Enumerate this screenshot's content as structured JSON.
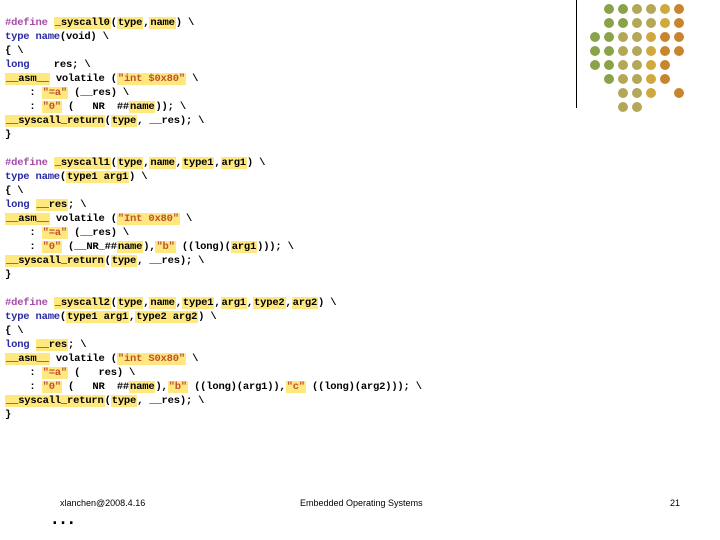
{
  "footer": {
    "left": "xlanchen@2008.4.16",
    "center": "Embedded Operating Systems",
    "page": "21"
  },
  "ellipsis": "…",
  "dot_colors": {
    "g": "#8aa34a",
    "go": "#b3a758",
    "o": "#cfa83e",
    "do": "#c7862e"
  },
  "dots_layout": [
    [
      "",
      "g",
      "g",
      "go",
      "go",
      "o",
      "do"
    ],
    [
      "",
      "g",
      "g",
      "go",
      "go",
      "o",
      "do"
    ],
    [
      "g",
      "g",
      "go",
      "go",
      "o",
      "do",
      "do"
    ],
    [
      "g",
      "g",
      "go",
      "go",
      "o",
      "do",
      "do"
    ],
    [
      "g",
      "g",
      "go",
      "go",
      "o",
      "do",
      ""
    ],
    [
      "",
      "g",
      "go",
      "go",
      "o",
      "do",
      ""
    ],
    [
      "",
      "",
      "go",
      "go",
      "o",
      "",
      "do"
    ],
    [
      "",
      "",
      "go",
      "go",
      "",
      "",
      ""
    ]
  ],
  "code": {
    "b0": {
      "l1a": "#define ",
      "l1b": "_syscall0",
      "l1c": "(",
      "l1d": "type",
      "l1e": ",",
      "l1f": "name",
      "l1g": ") \\",
      "l2a": "type name",
      "l2b": "(void) \\",
      "l3": "{ \\",
      "l4a": "long",
      "l4b": "    res; \\",
      "l5a": "__asm__",
      "l5b": " volatile (",
      "l5c": "\"int $0x80\"",
      "l5d": " \\",
      "l6a": "    : ",
      "l6b": "\"=a\"",
      "l6c": " (__res) \\",
      "l7a": "    : ",
      "l7b": "\"0\"",
      "l7c": " (   NR  ##",
      "l7d": "name",
      "l7e": ")); \\",
      "l8a": "__syscall_return",
      "l8b": "(",
      "l8c": "type",
      "l8d": ", __res); \\",
      "l9": "}"
    },
    "b1": {
      "l1a": "#define ",
      "l1b": "_syscall1",
      "l1c": "(",
      "l1d": "type",
      "l1e": ",",
      "l1f": "name",
      "l1g": ",",
      "l1h": "type1",
      "l1i": ",",
      "l1j": "arg1",
      "l1k": ") \\",
      "l2a": "type name",
      "l2b": "(",
      "l2c": "type1 arg1",
      "l2d": ") \\",
      "l3": "{ \\",
      "l4a": "long ",
      "l4b": "__res",
      "l4c": "; \\",
      "l5a": "__asm__",
      "l5b": " volatile (",
      "l5c": "\"Int 0x80\"",
      "l5d": " \\",
      "l6a": "    : ",
      "l6b": "\"=a\"",
      "l6c": " (__res) \\",
      "l7a": "    : ",
      "l7b": "\"0\"",
      "l7c": " (__NR_##",
      "l7d": "name",
      "l7e": "),",
      "l7f": "\"b\"",
      "l7g": " ((long)(",
      "l7h": "arg1",
      "l7i": "))); \\",
      "l8a": "__syscall_return",
      "l8b": "(",
      "l8c": "type",
      "l8d": ", __res); \\",
      "l9": "}"
    },
    "b2": {
      "l1a": "#define ",
      "l1b": "_syscall2",
      "l1c": "(",
      "l1d": "type",
      "l1e": ",",
      "l1f": "name",
      "l1g": ",",
      "l1h": "type1",
      "l1i": ",",
      "l1j": "arg1",
      "l1k": ",",
      "l1l": "type2",
      "l1m": ",",
      "l1n": "arg2",
      "l1o": ") \\",
      "l2a": "type name",
      "l2b": "(",
      "l2c": "type1 arg1",
      "l2d": ",",
      "l2e": "type2 arg2",
      "l2f": ") \\",
      "l3": "{ \\",
      "l4a": "long ",
      "l4b": "__res",
      "l4c": "; \\",
      "l5a": "__asm__",
      "l5b": " volatile (",
      "l5c": "\"int S0x80\"",
      "l5d": " \\",
      "l6a": "    : ",
      "l6b": "\"=a\"",
      "l6c": " (   res) \\",
      "l7a": "    : ",
      "l7b": "\"0\"",
      "l7c": " (   NR  ##",
      "l7d": "name",
      "l7e": "),",
      "l7f": "\"b\"",
      "l7g": " ((long)(arg1)),",
      "l7h": "\"c\"",
      "l7i": " ((long)(arg2))); \\",
      "l8a": "__syscall_return",
      "l8b": "(",
      "l8c": "type",
      "l8d": ", __res); \\",
      "l9": "}"
    }
  }
}
